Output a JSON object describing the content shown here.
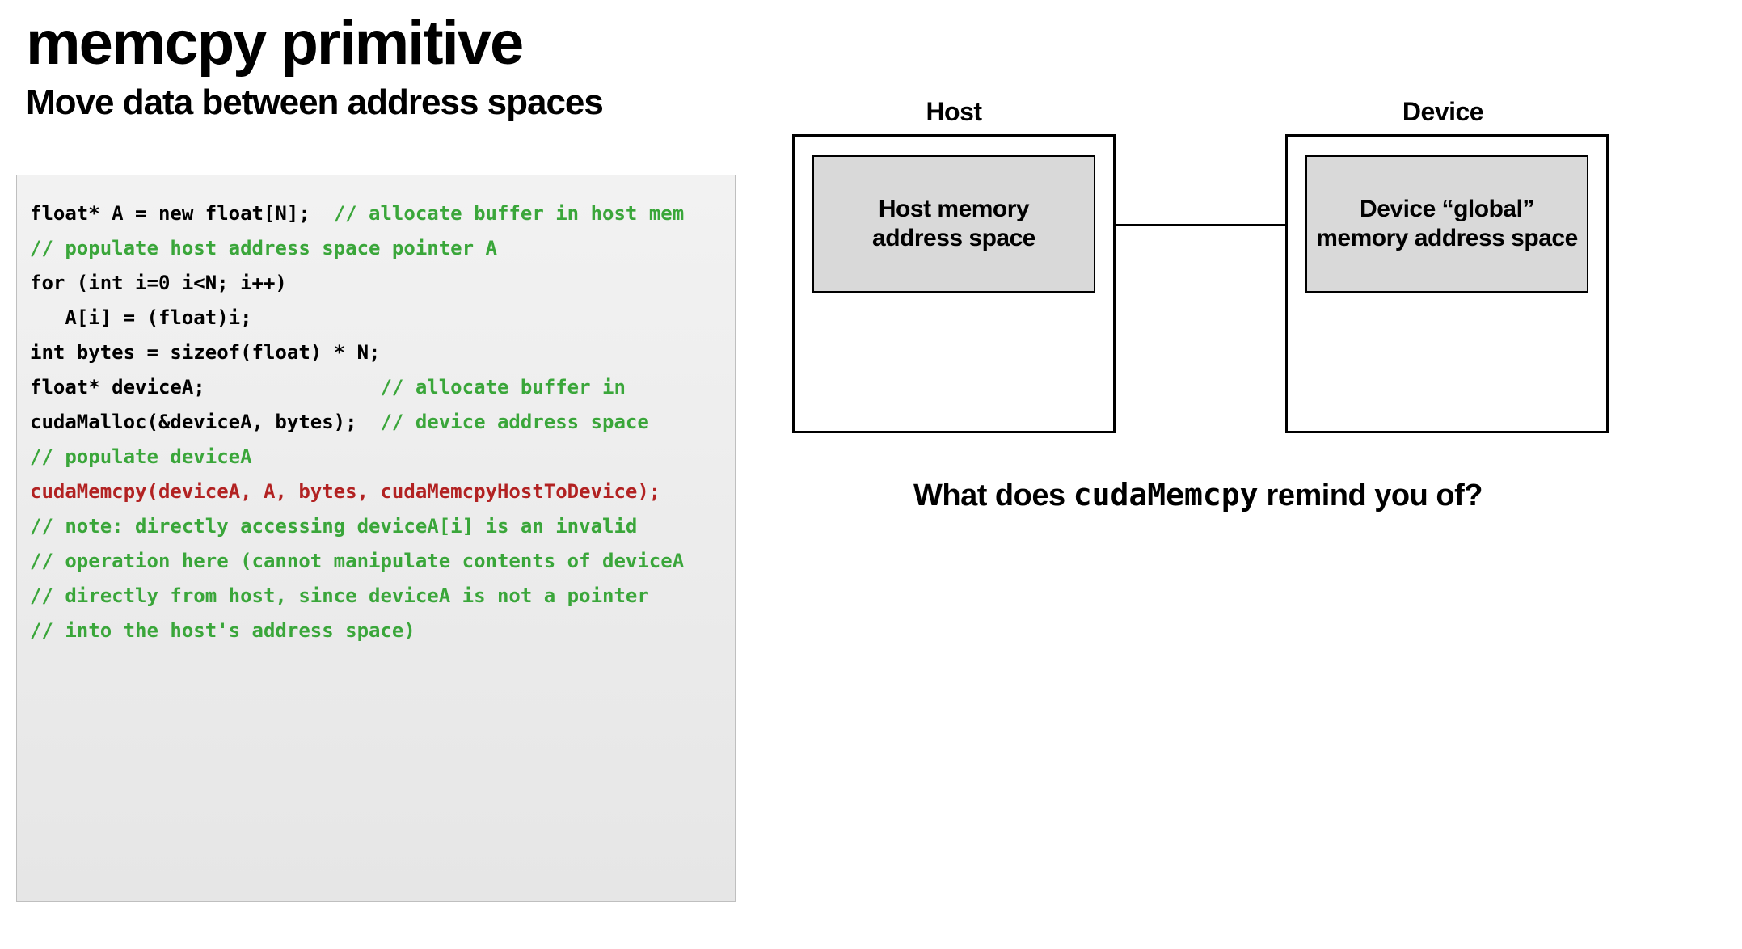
{
  "title": "memcpy primitive",
  "subtitle": "Move data between address spaces",
  "code": {
    "l1a": "float* A = new float[N];  ",
    "l1b": "// allocate buffer in host mem",
    "l2": "",
    "l3": "// populate host address space pointer A",
    "l4": "for (int i=0 i<N; i++)",
    "l5": "   A[i] = (float)i;",
    "l6": "",
    "l7": "int bytes = sizeof(float) * N;",
    "l8a": "float* deviceA;               ",
    "l8b": "// allocate buffer in ",
    "l9a": "cudaMalloc(&deviceA, bytes);  ",
    "l9b": "// device address space",
    "l10": "",
    "l11": "// populate deviceA",
    "l12": "cudaMemcpy(deviceA, A, bytes, cudaMemcpyHostToDevice);",
    "l13": "",
    "l14": "// note: directly accessing deviceA[i] is an invalid ",
    "l15": "// operation here (cannot manipulate contents of deviceA ",
    "l16": "// directly from host, since deviceA is not a pointer ",
    "l17": "// into the host's address space)"
  },
  "diagram": {
    "host_label": "Host",
    "device_label": "Device",
    "host_inner": "Host memory\naddress space",
    "device_inner": "Device “global”\nmemory address space"
  },
  "question": {
    "prefix": "What does ",
    "code": "cudaMemcpy",
    "suffix": " remind you of?"
  }
}
